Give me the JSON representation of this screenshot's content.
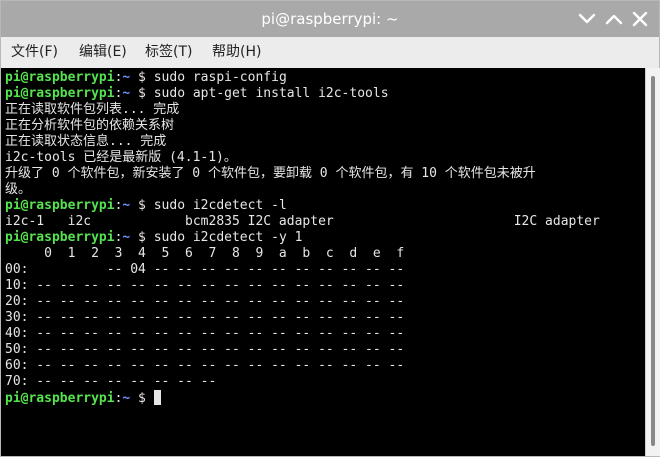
{
  "window": {
    "title": "pi@raspberrypi: ~",
    "menu": [
      {
        "label": "文件(F)"
      },
      {
        "label": "编辑(E)"
      },
      {
        "label": "标签(T)"
      },
      {
        "label": "帮助(H)"
      }
    ]
  },
  "prompt": {
    "user_host": "pi@raspberrypi",
    "sep": ":",
    "path": "~",
    "dollar": " $ "
  },
  "commands": {
    "c1": "sudo raspi-config",
    "c2": "sudo apt-get install i2c-tools",
    "c3": "sudo i2cdetect -l",
    "c4": "sudo i2cdetect -y 1"
  },
  "output": {
    "apt1": "正在读取软件包列表... 完成",
    "apt2": "正在分析软件包的依赖关系树",
    "apt3": "正在读取状态信息... 完成",
    "apt4": "i2c-tools 已经是最新版 (4.1-1)。",
    "apt5": "升级了 0 个软件包，新安装了 0 个软件包，要卸载 0 个软件包，有 10 个软件包未被升",
    "apt6": "级。",
    "bus_list": "i2c-1   i2c            bcm2835 I2C adapter                       I2C adapter",
    "grid": [
      "     0  1  2  3  4  5  6  7  8  9  a  b  c  d  e  f",
      "00:          -- 04 -- -- -- -- -- -- -- -- -- -- --",
      "10: -- -- -- -- -- -- -- -- -- -- -- -- -- -- -- --",
      "20: -- -- -- -- -- -- -- -- -- -- -- -- -- -- -- --",
      "30: -- -- -- -- -- -- -- -- -- -- -- -- -- -- -- --",
      "40: -- -- -- -- -- -- -- -- -- -- -- -- -- -- -- --",
      "50: -- -- -- -- -- -- -- -- -- -- -- -- -- -- -- --",
      "60: -- -- -- -- -- -- -- -- -- -- -- -- -- -- -- --",
      "70: -- -- -- -- -- -- -- --"
    ]
  },
  "colors": {
    "prompt_user": "#55e44e",
    "prompt_path": "#6f8dff",
    "terminal_bg": "#000000",
    "titlebar_bg": "#a9a9a9"
  },
  "icons": {
    "close": "close-icon",
    "minimize": "minimize-icon",
    "maximize": "maximize-icon"
  }
}
